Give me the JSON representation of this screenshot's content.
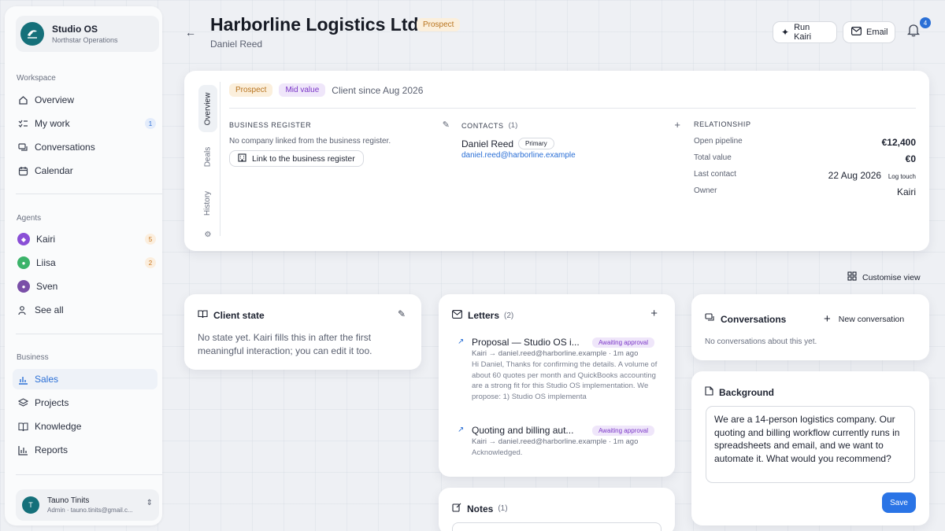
{
  "brand": {
    "name": "Studio OS",
    "subtitle": "Northstar Operations"
  },
  "sidebar": {
    "workspace_label": "Workspace",
    "workspace_items": [
      {
        "label": "Overview",
        "icon": "home-icon"
      },
      {
        "label": "My work",
        "icon": "checklist-icon",
        "badge": "1"
      },
      {
        "label": "Conversations",
        "icon": "chat-icon"
      },
      {
        "label": "Calendar",
        "icon": "calendar-icon"
      }
    ],
    "agents_label": "Agents",
    "agents": [
      {
        "label": "Kairi",
        "badge": "5",
        "color": "#8a4fd6"
      },
      {
        "label": "Liisa",
        "badge": "2",
        "color": "#3bb36a"
      },
      {
        "label": "Sven",
        "color": "#7a4fa8"
      }
    ],
    "see_all": "See all",
    "business_label": "Business",
    "business_items": [
      {
        "label": "Sales",
        "icon": "chart-icon",
        "active": true
      },
      {
        "label": "Projects",
        "icon": "layers-icon"
      },
      {
        "label": "Knowledge",
        "icon": "book-icon"
      },
      {
        "label": "Reports",
        "icon": "bar-chart-icon"
      }
    ],
    "user": {
      "initial": "T",
      "name": "Tauno Tinits",
      "sub": "Admin · tauno.tinits@gmail.c..."
    }
  },
  "header": {
    "title": "Harborline Logistics Ltd",
    "status": "Prospect",
    "contact": "Daniel Reed",
    "run_kairi": "Run Kairi",
    "email": "Email",
    "notifications": "4"
  },
  "overview": {
    "tabs": [
      "Overview",
      "Deals",
      "History"
    ],
    "pill_prospect": "Prospect",
    "pill_value": "Mid value",
    "client_since": "Client since Aug 2026",
    "business_register": {
      "title": "BUSINESS REGISTER",
      "empty": "No company linked from the business register.",
      "link_button": "Link to the business register"
    },
    "contacts": {
      "title": "CONTACTS",
      "count": "(1)",
      "name": "Daniel Reed",
      "tag": "Primary",
      "email": "daniel.reed@harborline.example"
    },
    "relationship": {
      "title": "RELATIONSHIP",
      "rows": [
        {
          "k": "Open pipeline",
          "v": "€12,400",
          "bold": true
        },
        {
          "k": "Total value",
          "v": "€0",
          "bold": true
        },
        {
          "k": "Last contact",
          "v": "22 Aug 2026",
          "extra": "Log touch"
        },
        {
          "k": "Owner",
          "v": "Kairi"
        }
      ]
    }
  },
  "customise_view": "Customise view",
  "client_state": {
    "title": "Client state",
    "body": "No state yet. Kairi fills this in after the first meaningful interaction; you can edit it too."
  },
  "letters": {
    "title": "Letters",
    "count": "(2)",
    "items": [
      {
        "subject": "Proposal — Studio OS i...",
        "status": "Awaiting approval",
        "meta": "Kairi → daniel.reed@harborline.example · 1m ago",
        "body": "Hi Daniel, Thanks for confirming the details. A volume of about 60 quotes per month and QuickBooks accounting are a strong fit for this Studio OS implementation. We propose: 1) Studio OS implementa"
      },
      {
        "subject": "Quoting and billing aut...",
        "status": "Awaiting approval",
        "meta": "Kairi → daniel.reed@harborline.example · 1m ago",
        "body": "Acknowledged."
      }
    ]
  },
  "notes": {
    "title": "Notes",
    "count": "(1)"
  },
  "conversations": {
    "title": "Conversations",
    "new": "New conversation",
    "empty": "No conversations about this yet."
  },
  "background": {
    "title": "Background",
    "text": "We are a 14-person logistics company. Our quoting and billing workflow currently runs in spreadsheets and email, and we want to automate it. What would you recommend?",
    "save": "Save"
  }
}
